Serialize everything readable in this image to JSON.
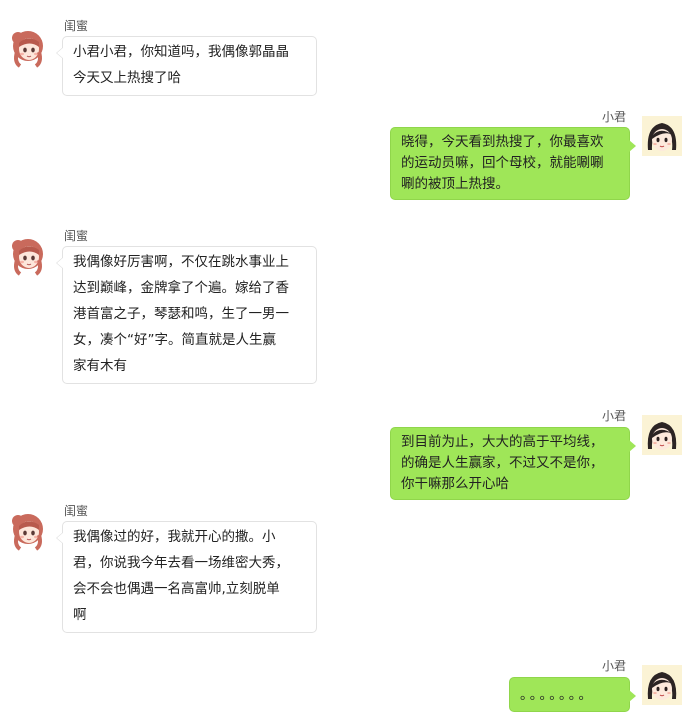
{
  "colors": {
    "incoming_bubble": "#ffffff",
    "outgoing_bubble": "#9fe658",
    "background": "#ffffff"
  },
  "participants": {
    "friend": {
      "name": "闺蜜",
      "avatar_icon": "anime-girl-red-hair-avatar"
    },
    "me": {
      "name": "小君",
      "avatar_icon": "cartoon-girl-black-hair-avatar"
    }
  },
  "messages": [
    {
      "sender": "闺蜜",
      "text": "小君小君，你知道吗，我偶像郭晶晶\n今天又上热搜了哈"
    },
    {
      "sender": "小君",
      "text": "晓得，今天看到热搜了，你最喜欢\n的运动员嘛，回个母校，就能唰唰\n唰的被顶上热搜。"
    },
    {
      "sender": "闺蜜",
      "text": "我偶像好厉害啊，不仅在跳水事业上\n达到巅峰，金牌拿了个遍。嫁给了香\n港首富之子，琴瑟和鸣，生了一男一\n女，凑个“好”字。简直就是人生赢\n家有木有"
    },
    {
      "sender": "小君",
      "text": "到目前为止，大大的高于平均线，\n的确是人生赢家，不过又不是你，\n你干嘛那么开心哈"
    },
    {
      "sender": "闺蜜",
      "text": "我偶像过的好，我就开心的撒。小\n君，你说我今年去看一场维密大秀，\n会不会也偶遇一名高富帅,立刻脱单\n啊"
    },
    {
      "sender": "小君",
      "text": "。。。。。。。"
    }
  ]
}
